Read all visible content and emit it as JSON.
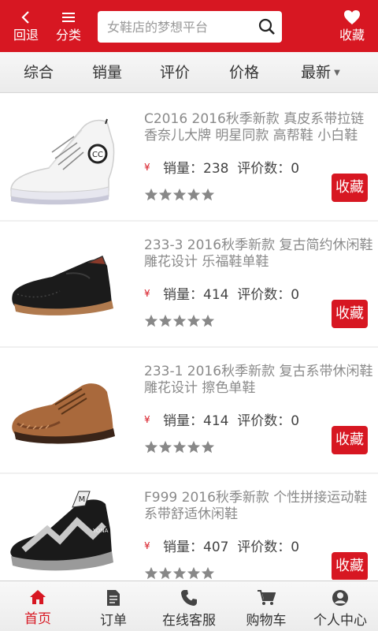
{
  "header": {
    "back_label": "回退",
    "category_label": "分类",
    "favorites_label": "收藏",
    "search_placeholder": "女鞋店的梦想平台"
  },
  "sort_tabs": [
    {
      "label": "综合"
    },
    {
      "label": "销量"
    },
    {
      "label": "评价"
    },
    {
      "label": "价格"
    },
    {
      "label": "最新",
      "has_dropdown": true
    }
  ],
  "products": [
    {
      "title": "C2016 2016秋季新款 真皮系带拉链香奈儿大牌 明星同款 高帮鞋 小白鞋",
      "price_symbol": "¥",
      "sales": "销量：238",
      "reviews": "评价数：0",
      "rating": 5,
      "fav_label": "收藏",
      "image": "white-high-top-sneaker"
    },
    {
      "title": "233-3 2016秋季新款 复古简约休闲鞋 雕花设计 乐福鞋单鞋",
      "price_symbol": "¥",
      "sales": "销量：414",
      "reviews": "评价数：0",
      "rating": 5,
      "fav_label": "收藏",
      "image": "black-brogue-loafer"
    },
    {
      "title": "233-1 2016秋季新款 复古系带休闲鞋 雕花设计 擦色单鞋",
      "price_symbol": "¥",
      "sales": "销量：414",
      "reviews": "评价数：0",
      "rating": 5,
      "fav_label": "收藏",
      "image": "brown-lace-up-shoe"
    },
    {
      "title": "F999 2016秋季新款 个性拼接运动鞋 系带舒适休闲鞋",
      "price_symbol": "¥",
      "sales": "销量：407",
      "reviews": "评价数：0",
      "rating": 5,
      "fav_label": "收藏",
      "image": "black-silver-sneaker"
    }
  ],
  "bottom_nav": [
    {
      "label": "首页",
      "icon": "home-icon",
      "active": true
    },
    {
      "label": "订单",
      "icon": "order-icon"
    },
    {
      "label": "在线客服",
      "icon": "phone-icon"
    },
    {
      "label": "购物车",
      "icon": "cart-icon"
    },
    {
      "label": "个人中心",
      "icon": "user-icon"
    }
  ],
  "colors": {
    "brand": "#d71722",
    "star": "#8a8a8a"
  }
}
